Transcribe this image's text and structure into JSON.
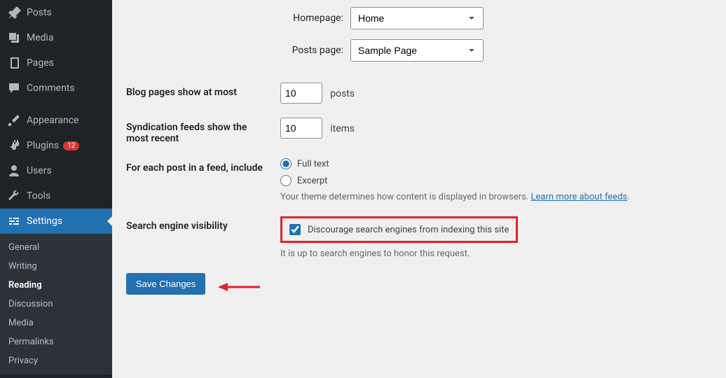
{
  "sidebar": {
    "items": [
      {
        "label": "Posts"
      },
      {
        "label": "Media"
      },
      {
        "label": "Pages"
      },
      {
        "label": "Comments"
      },
      {
        "label": "Appearance"
      },
      {
        "label": "Plugins",
        "badge": "12"
      },
      {
        "label": "Users"
      },
      {
        "label": "Tools"
      },
      {
        "label": "Settings"
      }
    ],
    "submenu": [
      {
        "label": "General"
      },
      {
        "label": "Writing"
      },
      {
        "label": "Reading"
      },
      {
        "label": "Discussion"
      },
      {
        "label": "Media"
      },
      {
        "label": "Permalinks"
      },
      {
        "label": "Privacy"
      }
    ]
  },
  "homepage": {
    "label": "Homepage:",
    "selected": "Home"
  },
  "postspage": {
    "label": "Posts page:",
    "selected": "Sample Page"
  },
  "blogpages": {
    "label": "Blog pages show at most",
    "value": "10",
    "suffix": "posts"
  },
  "syndication": {
    "label": "Syndication feeds show the most recent",
    "value": "10",
    "suffix": "items"
  },
  "feed_include": {
    "label": "For each post in a feed, include",
    "options": [
      "Full text",
      "Excerpt"
    ],
    "help_prefix": "Your theme determines how content is displayed in browsers. ",
    "help_link": "Learn more about feeds",
    "help_suffix": "."
  },
  "search_visibility": {
    "label": "Search engine visibility",
    "checkbox_label": "Discourage search engines from indexing this site",
    "checked": true,
    "help": "It is up to search engines to honor this request."
  },
  "save_button": "Save Changes"
}
